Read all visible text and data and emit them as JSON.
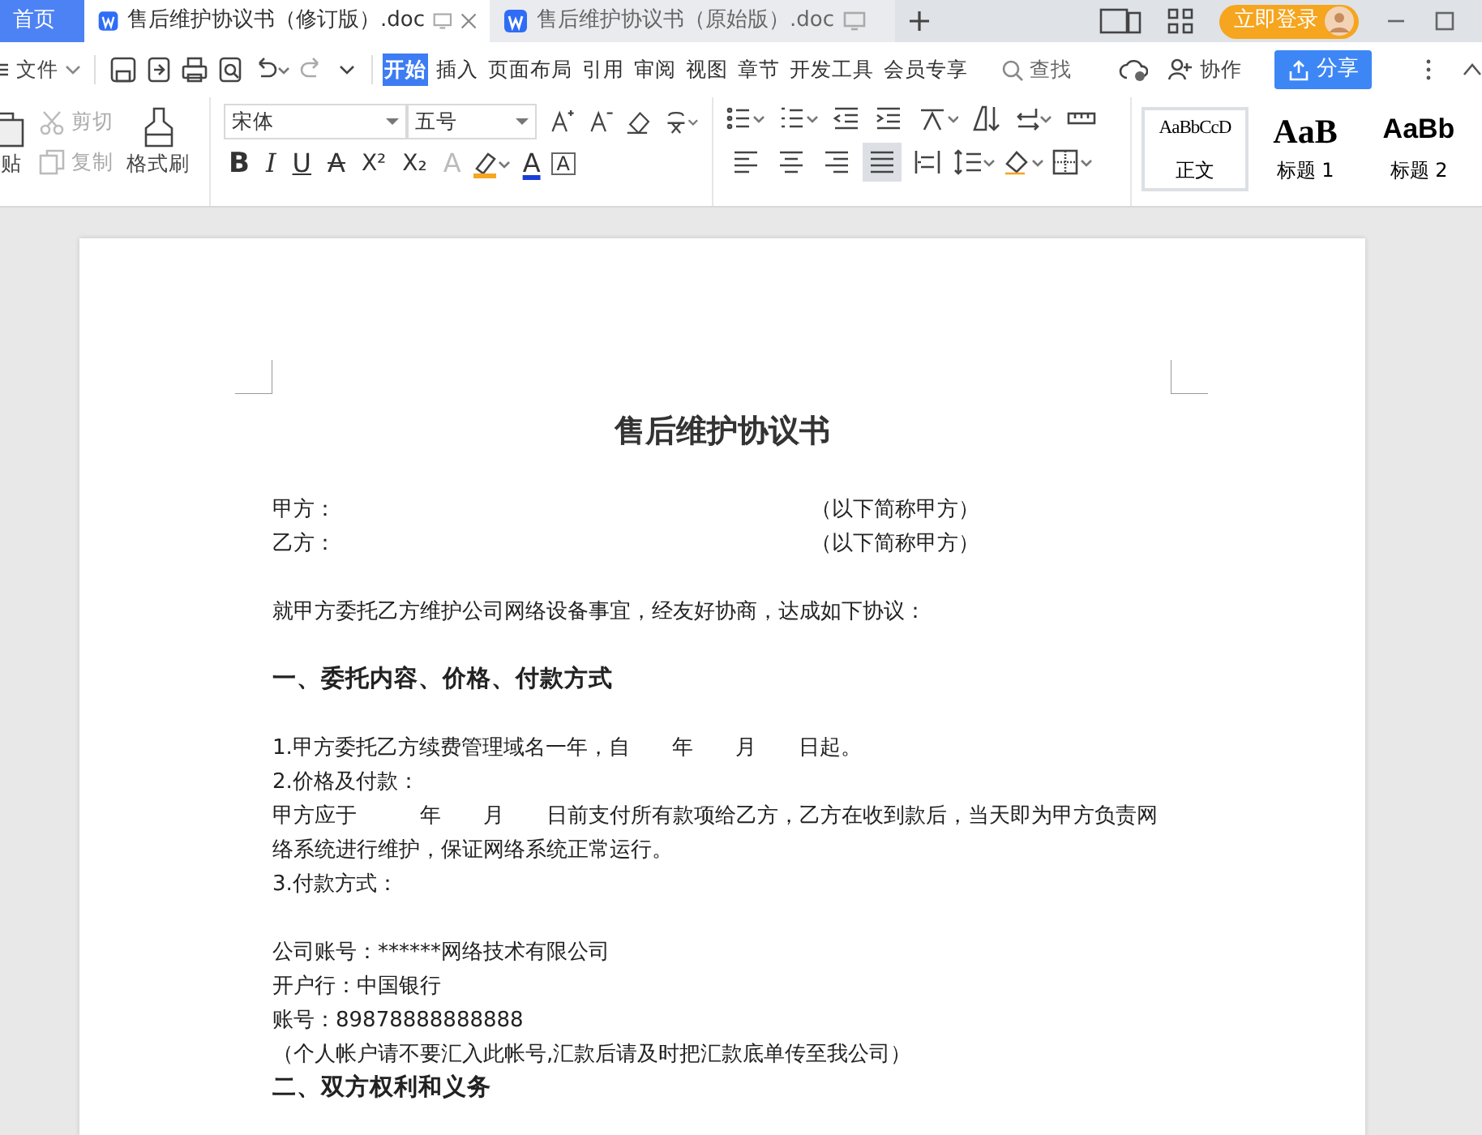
{
  "tabs": [
    {
      "kind": "home",
      "label": "首页",
      "selected": false
    },
    {
      "kind": "doc",
      "label": "售后维护协议书（修订版）.doc",
      "selected": true
    },
    {
      "kind": "doc",
      "label": "售后维护协议书（原始版）.doc",
      "selected": false
    }
  ],
  "login_button": "立即登录",
  "menu": {
    "file": "文件",
    "ribbon_tabs": [
      {
        "label": "开始",
        "selected": true
      },
      {
        "label": "插入",
        "selected": false
      },
      {
        "label": "页面布局",
        "selected": false
      },
      {
        "label": "引用",
        "selected": false
      },
      {
        "label": "审阅",
        "selected": false
      },
      {
        "label": "视图",
        "selected": false
      },
      {
        "label": "章节",
        "selected": false
      },
      {
        "label": "开发工具",
        "selected": false
      },
      {
        "label": "会员专享",
        "selected": false
      }
    ],
    "search": "查找",
    "collaborate": "协作",
    "share": "分享"
  },
  "ribbon": {
    "clipboard": {
      "paste": "贴",
      "cut": {
        "label": "剪切",
        "disabled": true
      },
      "copy": {
        "label": "复制",
        "disabled": true
      },
      "format_painter": "格式刷"
    },
    "font": {
      "name": "宋体",
      "size": "五号",
      "format_buttons": [
        {
          "kind": "bold",
          "glyph": "B"
        },
        {
          "kind": "italic",
          "glyph": "I"
        },
        {
          "kind": "underline",
          "glyph": "U"
        },
        {
          "kind": "strike",
          "glyph": "A"
        },
        {
          "kind": "sup",
          "glyph": "X²"
        },
        {
          "kind": "sub",
          "glyph": "X₂"
        },
        {
          "kind": "effect",
          "glyph": "A"
        },
        {
          "kind": "highlight"
        },
        {
          "kind": "color",
          "glyph": "A"
        },
        {
          "kind": "boxed",
          "glyph": "A"
        }
      ]
    },
    "alignments": [
      {
        "kind": "left",
        "selected": false
      },
      {
        "kind": "center",
        "selected": false
      },
      {
        "kind": "right",
        "selected": false
      },
      {
        "kind": "justify",
        "selected": true
      },
      {
        "kind": "distributed",
        "selected": false
      }
    ],
    "styles": [
      {
        "kind": "body",
        "preview": "AaBbCcD",
        "label": "正文",
        "selected": true
      },
      {
        "kind": "h1",
        "preview": "AaB",
        "label": "标题 1",
        "selected": false
      },
      {
        "kind": "h2",
        "preview": "AaBb",
        "label": "标题 2",
        "selected": false
      }
    ]
  },
  "document": {
    "title": "售后维护协议书",
    "blocks": [
      [
        {
          "kind": "party",
          "label": "甲方：",
          "note": "（以下简称甲方）"
        },
        {
          "kind": "party",
          "label": "乙方：",
          "note": "（以下简称甲方）"
        }
      ],
      [
        {
          "kind": "text",
          "text": "就甲方委托乙方维护公司网络设备事宜，经友好协商，达成如下协议："
        }
      ],
      [
        {
          "kind": "heading",
          "text": "一、委托内容、价格、付款方式"
        }
      ],
      [
        {
          "kind": "text",
          "text": "1.甲方委托乙方续费管理域名一年，自　　年　　月　　日起。"
        },
        {
          "kind": "text",
          "text": "2.价格及付款："
        },
        {
          "kind": "text",
          "text": "甲方应于　　　年　　月　　日前支付所有款项给乙方，乙方在收到款后，当天即为甲方负责网络系统进行维护，保证网络系统正常运行。"
        },
        {
          "kind": "text",
          "text": "3.付款方式："
        }
      ],
      [
        {
          "kind": "text",
          "text": "公司账号：******网络技术有限公司"
        },
        {
          "kind": "text",
          "text": "开户行：中国银行"
        },
        {
          "kind": "text",
          "text": "账号：89878888888888"
        },
        {
          "kind": "text",
          "text": "（个人帐户请不要汇入此帐号,汇款后请及时把汇款底单传至我公司）"
        },
        {
          "kind": "heading",
          "text": "二、双方权利和义务"
        }
      ]
    ]
  }
}
